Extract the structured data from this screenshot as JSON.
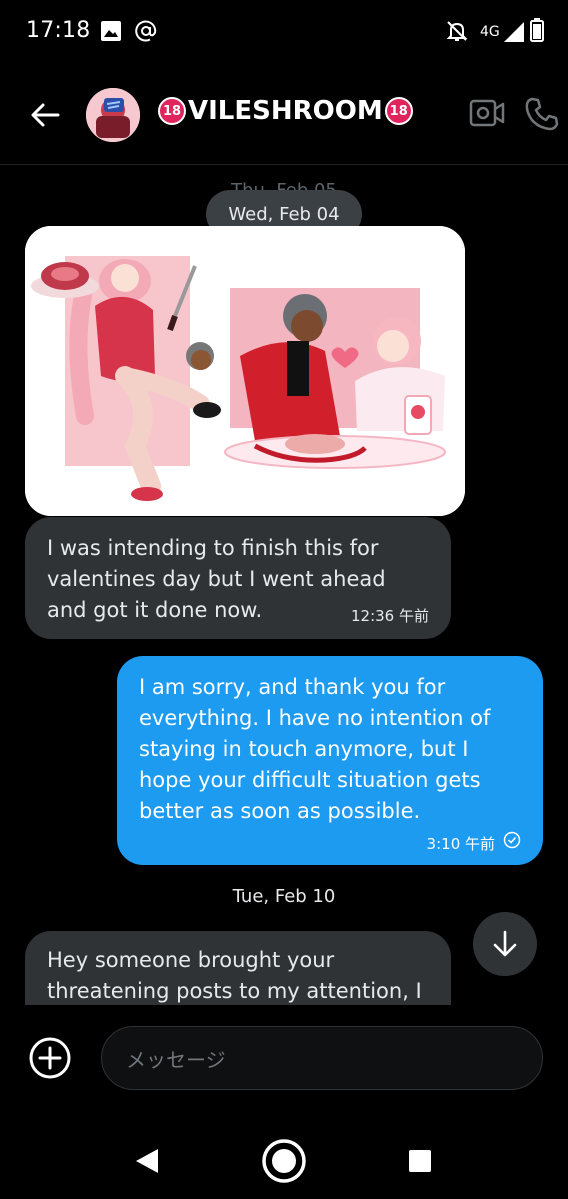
{
  "status_bar": {
    "time": "17:18",
    "network": "4G",
    "icons": [
      "image-icon",
      "at-icon",
      "notifications-off-icon",
      "signal-icon",
      "battery-icon"
    ]
  },
  "header": {
    "back_icon": "back-arrow-icon",
    "contact_name": "VILESHROOM",
    "badge_text": "18",
    "video_icon": "video-call-icon",
    "phone_icon": "phone-icon"
  },
  "conversation": {
    "ghost_date": "Thu, Feb 05",
    "date_chip": "Wed, Feb 04",
    "image_message": {
      "alt": "image-attachment"
    },
    "incoming_1": {
      "lines": [
        "I was intending to finish this for",
        "valentines day but I went ahead",
        "and got it done now."
      ],
      "time": "12:36 午前"
    },
    "outgoing_1": {
      "lines": [
        "I am sorry, and thank you for",
        "everything. I have no intention of",
        "staying in touch anymore, but I",
        "hope your difficult situation gets",
        "better as soon as possible."
      ],
      "time": "3:10 午前"
    },
    "date_2": "Tue, Feb 10",
    "incoming_2": {
      "lines": [
        "Hey someone brought your",
        "threatening posts to my attention, I"
      ]
    }
  },
  "composer": {
    "placeholder": "メッセージ",
    "add_icon": "add-media-icon"
  },
  "colors": {
    "accent": "#1d9bf0",
    "incoming_bubble": "#2f3336",
    "background": "#000000"
  }
}
